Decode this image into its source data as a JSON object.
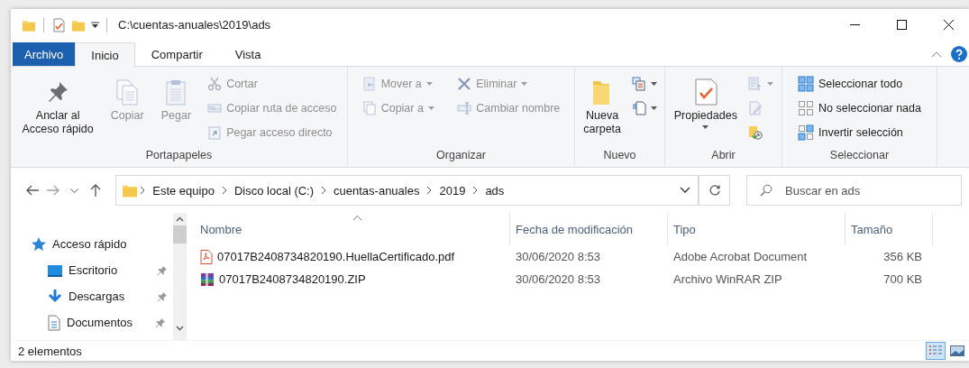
{
  "window": {
    "title": "C:\\cuentas-anuales\\2019\\ads"
  },
  "tabs": [
    {
      "label": "Archivo",
      "kind": "file",
      "selected": false
    },
    {
      "label": "Inicio",
      "kind": "tab",
      "selected": true
    },
    {
      "label": "Compartir",
      "kind": "tab",
      "selected": false
    },
    {
      "label": "Vista",
      "kind": "tab",
      "selected": false
    }
  ],
  "ribbon": {
    "groups": [
      {
        "label": "Portapapeles",
        "columns": [
          {
            "kind": "large",
            "items": [
              {
                "label": "Anclar al\nAcceso rápido",
                "disabled": false,
                "dropdown": false
              }
            ]
          },
          {
            "kind": "large",
            "items": [
              {
                "label": "Copiar",
                "disabled": true,
                "dropdown": false
              }
            ]
          },
          {
            "kind": "large",
            "items": [
              {
                "label": "Pegar",
                "disabled": true,
                "dropdown": false
              }
            ]
          },
          {
            "kind": "small",
            "items": [
              {
                "label": "Cortar",
                "disabled": true,
                "dropdown": false
              },
              {
                "label": "Copiar ruta de acceso",
                "disabled": true,
                "dropdown": false
              },
              {
                "label": "Pegar acceso directo",
                "disabled": true,
                "dropdown": false
              }
            ]
          }
        ]
      },
      {
        "label": "Organizar",
        "columns": [
          {
            "kind": "small",
            "items": [
              {
                "label": "Mover a",
                "disabled": true,
                "dropdown": true
              },
              {
                "label": "Copiar a",
                "disabled": true,
                "dropdown": true
              }
            ]
          },
          {
            "kind": "small",
            "items": [
              {
                "label": "Eliminar",
                "disabled": true,
                "dropdown": true
              },
              {
                "label": "Cambiar nombre",
                "disabled": true,
                "dropdown": false
              }
            ]
          }
        ]
      },
      {
        "label": "Nuevo",
        "columns": [
          {
            "kind": "large",
            "items": [
              {
                "label": "Nueva\ncarpeta",
                "disabled": false,
                "dropdown": false
              }
            ]
          },
          {
            "kind": "small",
            "items": [
              {
                "disabled": false,
                "dropdown": true
              },
              {
                "disabled": false,
                "dropdown": true
              }
            ]
          }
        ]
      },
      {
        "label": "Abrir",
        "columns": [
          {
            "kind": "large",
            "items": [
              {
                "label": "Propiedades",
                "disabled": false,
                "dropdown": true
              }
            ]
          },
          {
            "kind": "small",
            "items": [
              {
                "disabled": true,
                "dropdown": true
              },
              {
                "disabled": true,
                "dropdown": false
              },
              {
                "disabled": false,
                "dropdown": false
              }
            ]
          }
        ]
      },
      {
        "label": "Seleccionar",
        "columns": [
          {
            "kind": "small",
            "items": [
              {
                "label": "Seleccionar todo",
                "disabled": false,
                "dropdown": false
              },
              {
                "label": "No seleccionar nada",
                "disabled": false,
                "dropdown": false
              },
              {
                "label": "Invertir selección",
                "disabled": false,
                "dropdown": false
              }
            ]
          }
        ]
      }
    ]
  },
  "nav_buttons": [
    {
      "kind": "back",
      "disabled": false
    },
    {
      "kind": "forward",
      "disabled": true
    },
    {
      "kind": "recent",
      "disabled": false
    },
    {
      "kind": "up",
      "disabled": false
    }
  ],
  "address": {
    "segments": [
      "Este equipo",
      "Disco local (C:)",
      "cuentas-anuales",
      "2019",
      "ads"
    ]
  },
  "search": {
    "placeholder": "Buscar en ads"
  },
  "nav_pane": {
    "items": [
      {
        "label": "Acceso rápido",
        "kind": "quick",
        "pinned": false
      },
      {
        "label": "Escritorio",
        "kind": "desktop",
        "pinned": true
      },
      {
        "label": "Descargas",
        "kind": "downloads",
        "pinned": true
      },
      {
        "label": "Documentos",
        "kind": "documents",
        "pinned": true
      }
    ]
  },
  "files": {
    "columns": [
      {
        "label": "Nombre",
        "sorted": true
      },
      {
        "label": "Fecha de modificación",
        "sorted": false
      },
      {
        "label": "Tipo",
        "sorted": false
      },
      {
        "label": "Tamaño",
        "sorted": false
      }
    ],
    "rows": [
      {
        "kind": "pdf",
        "name": "07017B2408734820190.HuellaCertificado.pdf",
        "modified": "30/06/2020 8:53",
        "type": "Adobe Acrobat Document",
        "size": "356 KB"
      },
      {
        "kind": "zip",
        "name": "07017B2408734820190.ZIP",
        "modified": "30/06/2020 8:53",
        "type": "Archivo WinRAR ZIP",
        "size": "700 KB"
      }
    ]
  },
  "status_bar": {
    "text": "2 elementos",
    "views": [
      {
        "kind": "details",
        "selected": true
      },
      {
        "kind": "large-icons",
        "selected": false
      }
    ]
  }
}
